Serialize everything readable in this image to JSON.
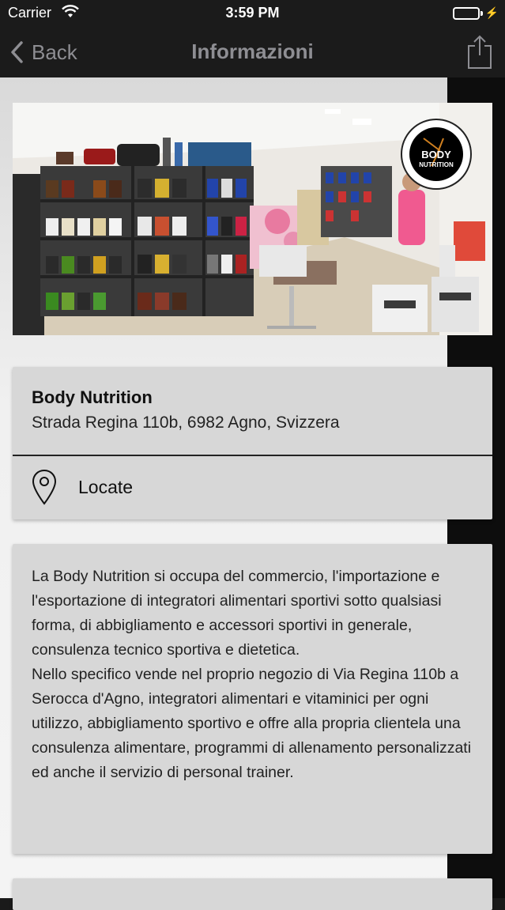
{
  "status_bar": {
    "carrier": "Carrier",
    "time": "3:59 PM",
    "battery_color": "#4cd964"
  },
  "nav": {
    "back_label": "Back",
    "title": "Informazioni",
    "share_icon": "share-icon"
  },
  "store": {
    "name": "Body Nutrition",
    "address": "Strada Regina 110b, 6982 Agno, Svizzera",
    "locate_label": "Locate",
    "locate_icon": "map-pin-icon"
  },
  "photo": {
    "logo_line1": "BODY",
    "logo_line2": "NUTRITION"
  },
  "description": {
    "paragraph1": "La Body Nutrition si occupa del commercio, l'importazione e l'esportazione di integratori alimentari sportivi sotto qualsiasi forma, di abbigliamento e accessori sportivi in generale, consulenza tecnico sportiva e dietetica.",
    "paragraph2": "Nello specifico vende nel proprio negozio di Via Regina 110b a Serocca d'Agno, integratori alimentari e vitaminici per ogni utilizzo, abbigliamento sportivo e offre alla propria clientela una consulenza alimentare, programmi di allenamento personalizzati ed anche il servizio di personal trainer."
  }
}
